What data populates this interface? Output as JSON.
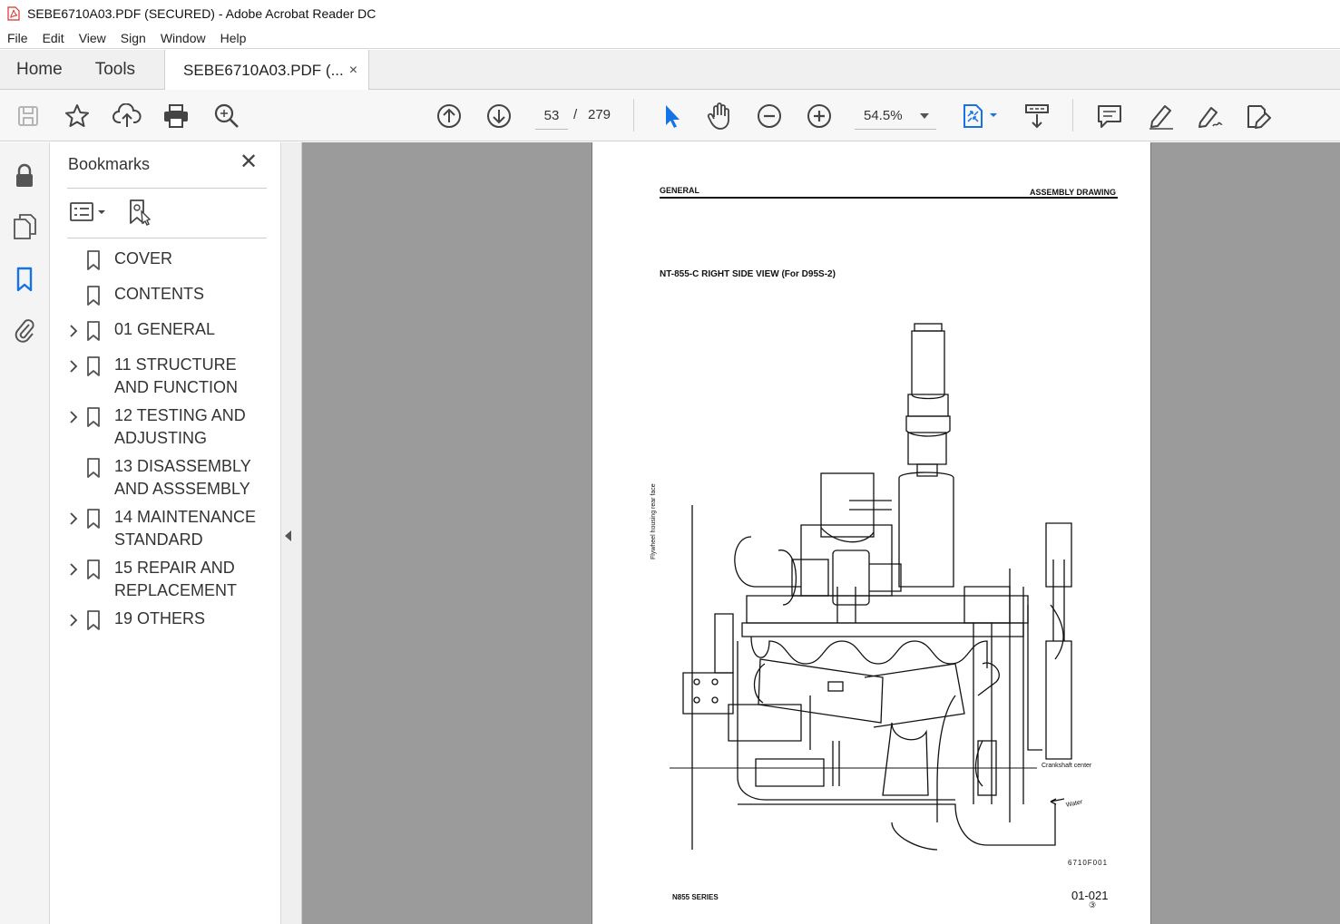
{
  "window": {
    "title": "SEBE6710A03.PDF (SECURED) - Adobe Acrobat Reader DC"
  },
  "menu": [
    "File",
    "Edit",
    "View",
    "Sign",
    "Window",
    "Help"
  ],
  "tabs": {
    "home": "Home",
    "tools": "Tools",
    "document": "SEBE6710A03.PDF (...",
    "close_glyph": "×"
  },
  "toolbar": {
    "page_current": "53",
    "page_separator": "/",
    "page_total": "279",
    "zoom": "54.5%",
    "icons": [
      "save-icon",
      "bookmark-star-icon",
      "upload-cloud-icon",
      "print-icon",
      "find-zoom-icon",
      "page-up-icon",
      "page-down-icon",
      "select-cursor-icon",
      "hand-tool-icon",
      "zoom-out-icon",
      "zoom-in-icon",
      "page-fit-icon",
      "scroll-mode-icon",
      "comment-icon",
      "highlight-pen-icon",
      "fill-sign-icon",
      "more-tools-icon"
    ]
  },
  "rail": {
    "icons": [
      "lock-icon",
      "pages-icon",
      "bookmarks-icon",
      "attachments-icon"
    ]
  },
  "bookmarks": {
    "title": "Bookmarks",
    "close_glyph": "✕",
    "items": [
      {
        "label": "COVER",
        "expandable": false
      },
      {
        "label": "CONTENTS",
        "expandable": false
      },
      {
        "label": "01 GENERAL",
        "expandable": true
      },
      {
        "label": "11 STRUCTURE AND FUNCTION",
        "expandable": true
      },
      {
        "label": "12 TESTING AND ADJUSTING",
        "expandable": true
      },
      {
        "label": "13 DISASSEMBLY AND ASSSEMBLY",
        "expandable": false
      },
      {
        "label": "14 MAINTENANCE STANDARD",
        "expandable": true
      },
      {
        "label": "15 REPAIR AND REPLACEMENT",
        "expandable": true
      },
      {
        "label": "19 OTHERS",
        "expandable": true
      }
    ]
  },
  "page": {
    "header_left": "GENERAL",
    "header_right": "ASSEMBLY DRAWING",
    "subtitle": "NT-855-C  RIGHT SIDE VIEW (For D95S-2)",
    "label_flywheel": "Flywheel housing rear face",
    "label_crank": "Crankshaft center",
    "label_water": "Water",
    "figure_code": "6710F001",
    "footer_left": "N855 SERIES",
    "footer_right": "01-021",
    "footer_rev": "③"
  },
  "colors": {
    "accent_blue": "#1473e6",
    "doc_background": "#9b9b9b",
    "pdf_red": "#d9322b"
  }
}
